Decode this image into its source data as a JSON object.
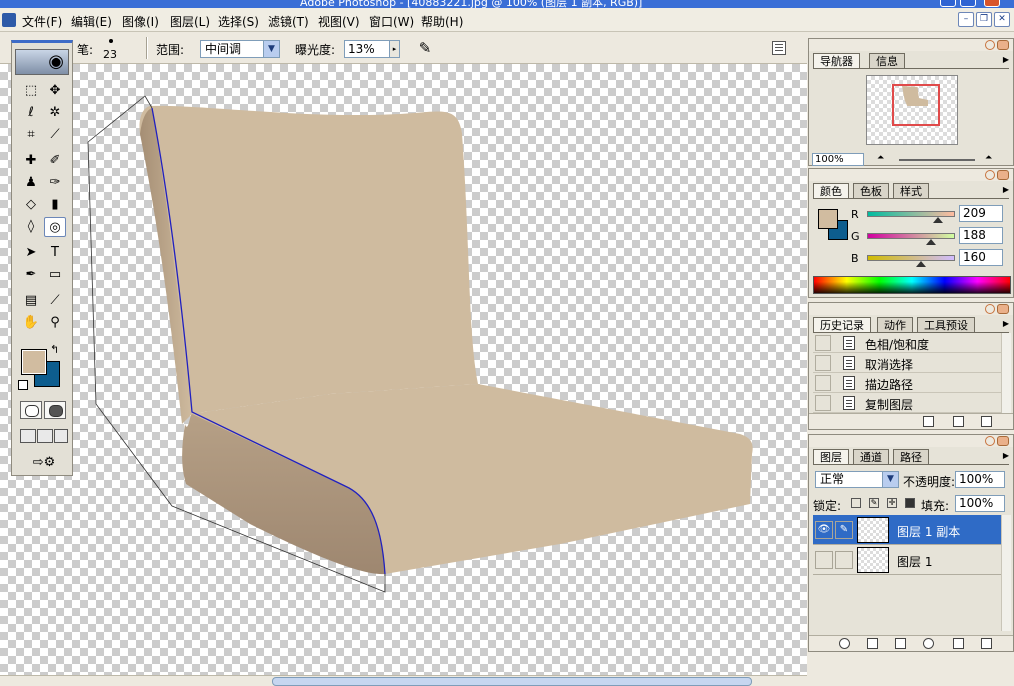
{
  "window": {
    "title": "Adobe Photoshop - [40883221.jpg @ 100% (图层 1 副本, RGB)]"
  },
  "menu": [
    "文件(F)",
    "编辑(E)",
    "图像(I)",
    "图层(L)",
    "选择(S)",
    "滤镜(T)",
    "视图(V)",
    "窗口(W)",
    "帮助(H)"
  ],
  "options": {
    "brush_label": "笔:",
    "brush_size": "23",
    "range_label": "范围:",
    "range_value": "中间调",
    "exposure_label": "曝光度:",
    "exposure_value": "13%"
  },
  "colors": {
    "foreground": "#d1bca0",
    "background": "#0d5d8e",
    "cushion": "#cfbb9f",
    "cushion_shadow": "#a58e74",
    "path_stroke": "#2020c0"
  },
  "navigator": {
    "tabs": [
      "导航器",
      "信息"
    ],
    "zoom": "100%"
  },
  "color_panel": {
    "tabs": [
      "颜色",
      "色板",
      "样式"
    ],
    "r_label": "R",
    "g_label": "G",
    "b_label": "B",
    "r": "209",
    "g": "188",
    "b": "160"
  },
  "history": {
    "tabs": [
      "历史记录",
      "动作",
      "工具预设"
    ],
    "items": [
      "色相/饱和度",
      "取消选择",
      "描边路径",
      "复制图层"
    ]
  },
  "layers": {
    "tabs": [
      "图层",
      "通道",
      "路径"
    ],
    "blend_mode": "正常",
    "opacity_label": "不透明度:",
    "opacity": "100%",
    "lock_label": "锁定:",
    "fill_label": "填充:",
    "fill": "100%",
    "items": [
      {
        "name": "图层 1 副本",
        "selected": true,
        "visible": true
      },
      {
        "name": "图层 1",
        "selected": false,
        "visible": false
      }
    ]
  },
  "icons": {
    "tools": [
      "marquee-icon",
      "move-icon",
      "lasso-icon",
      "magic-wand-icon",
      "crop-icon",
      "slice-icon",
      "healing-brush-icon",
      "brush-icon",
      "clone-stamp-icon",
      "history-brush-icon",
      "eraser-icon",
      "gradient-icon",
      "blur-icon",
      "dodge-icon",
      "path-select-icon",
      "type-icon",
      "pen-icon",
      "shape-icon",
      "notes-icon",
      "eyedropper-icon",
      "hand-icon",
      "zoom-icon"
    ]
  }
}
